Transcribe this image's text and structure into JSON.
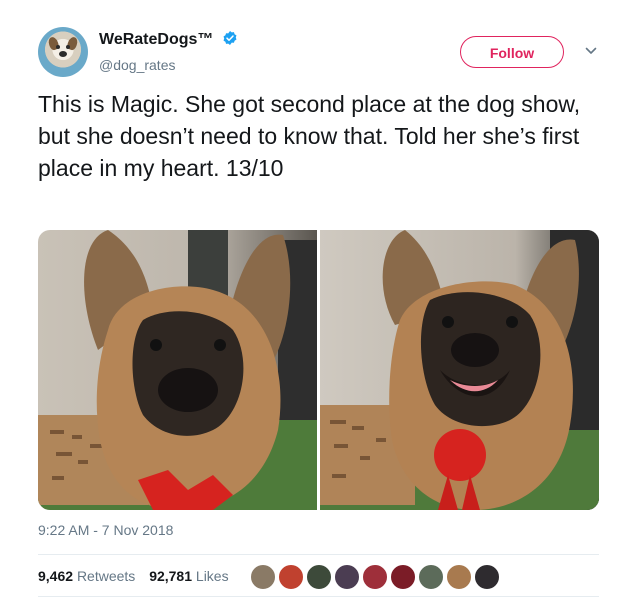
{
  "account": {
    "name": "WeRateDogs™",
    "handle": "@dog_rates",
    "verified_color": "#1da1f2"
  },
  "actions": {
    "follow_label": "Follow",
    "more_icon": "chevron-down-icon"
  },
  "tweet": {
    "text": "This is Magic. She got second place at the dog show, but she doesn’t need to know that. Told her she’s first place in my heart. 13/10",
    "timestamp": "9:22 AM - 7 Nov 2018"
  },
  "stats": {
    "retweets_count": "9,462",
    "retweets_label": "Retweets",
    "likes_count": "92,781",
    "likes_label": "Likes"
  },
  "colors": {
    "accent": "#e0245e",
    "secondary_text": "#657786"
  },
  "liker_avatars": [
    {
      "color": "#8a7a66"
    },
    {
      "color": "#c0412f"
    },
    {
      "color": "#3d4a3a"
    },
    {
      "color": "#4b3d52"
    },
    {
      "color": "#9e2f3a"
    },
    {
      "color": "#7b1c27"
    },
    {
      "color": "#5c6b5a"
    },
    {
      "color": "#a87a4f"
    },
    {
      "color": "#2e2b2f"
    }
  ]
}
